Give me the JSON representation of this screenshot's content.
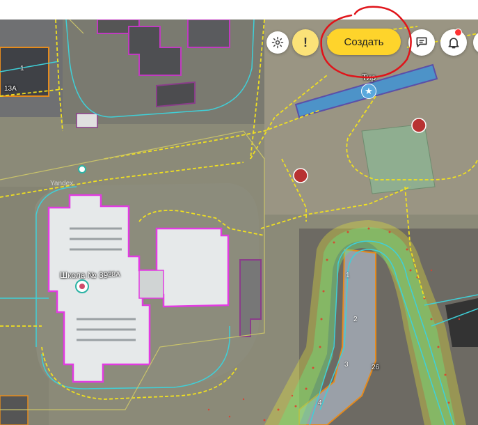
{
  "toolbar": {
    "create_label": "Создать",
    "settings_icon": "gear-icon",
    "alert_icon": "exclamation-icon",
    "feedback_icon": "chat-icon",
    "notifications_icon": "bell-icon",
    "accent_color": "#fed42b",
    "badge_color": "#ff3333"
  },
  "map": {
    "labels": {
      "shooting_range": "Тир",
      "school": "Школа № 39",
      "school_house": "28А",
      "house_13a": "13А",
      "house_26": "26",
      "house_num_1_top": "1",
      "entrance_1": "1",
      "entrance_2": "2",
      "entrance_3": "3",
      "entrance_4": "4",
      "watermark": "Yandex"
    }
  }
}
